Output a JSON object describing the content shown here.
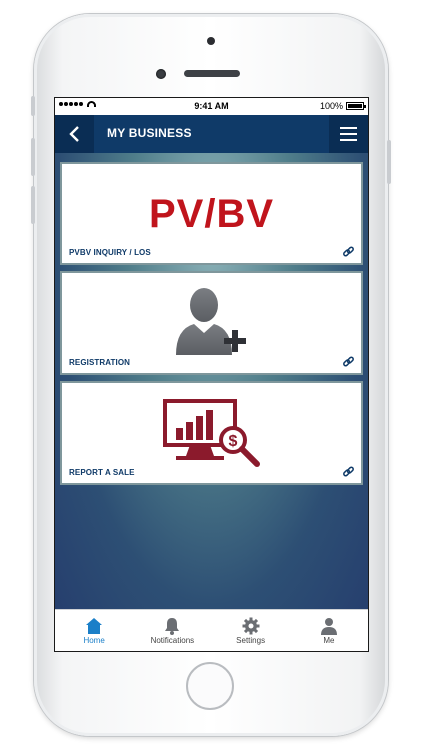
{
  "statusbar": {
    "time": "9:41 AM",
    "battery": "100%"
  },
  "header": {
    "title": "MY BUSINESS"
  },
  "cards": [
    {
      "label": "PVBV INQUIRY / LOS",
      "graphic_text": "PV/BV",
      "icon": "link-icon"
    },
    {
      "label": "REGISTRATION",
      "graphic": "add-user-icon",
      "icon": "link-icon"
    },
    {
      "label": "REPORT A SALE",
      "graphic": "sales-report-icon",
      "icon": "link-icon"
    }
  ],
  "tabs": [
    {
      "label": "Home",
      "icon": "home-icon",
      "active": true
    },
    {
      "label": "Notifications",
      "icon": "bell-icon",
      "active": false
    },
    {
      "label": "Settings",
      "icon": "gear-icon",
      "active": false
    },
    {
      "label": "Me",
      "icon": "person-icon",
      "active": false
    }
  ],
  "colors": {
    "header": "#0f3a68",
    "accent_red": "#c0141c",
    "graphic_maroon": "#8b1a2c",
    "tab_active": "#1a7fc8"
  }
}
